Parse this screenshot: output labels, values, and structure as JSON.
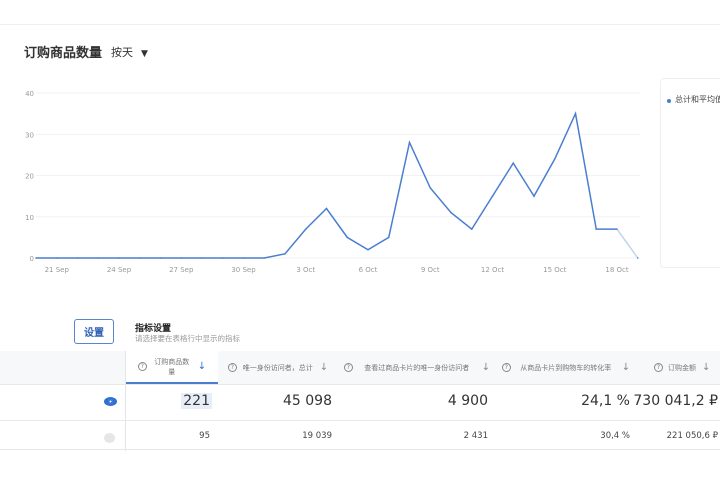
{
  "header": {
    "title": "订购商品数量",
    "period": "按天"
  },
  "legend": {
    "label": "总计和平均值"
  },
  "settings": {
    "button": "设置",
    "title": "指标设置",
    "subtitle": "请选择要在表格行中显示的指标"
  },
  "table": {
    "columns": [
      {
        "label": "订购商品数量"
      },
      {
        "label": "唯一身份访问者，总计"
      },
      {
        "label": "查看过商品卡片的唯一身份访问者"
      },
      {
        "label": "从商品卡片到购物车的转化率"
      },
      {
        "label": "订购金额"
      }
    ],
    "rows": [
      {
        "values": [
          "221",
          "45 098",
          "4 900",
          "24,1 %",
          "730 041,2 ₽"
        ]
      },
      {
        "values": [
          "95",
          "19 039",
          "2 431",
          "30,4 %",
          "221 050,6 ₽"
        ]
      }
    ]
  },
  "colors": {
    "accent": "#4a7ed0"
  },
  "chart_data": {
    "type": "line",
    "title": "订购商品数量",
    "x": [
      "20 Sep",
      "21 Sep",
      "22 Sep",
      "23 Sep",
      "24 Sep",
      "25 Sep",
      "26 Sep",
      "27 Sep",
      "28 Sep",
      "29 Sep",
      "30 Sep",
      "1 Oct",
      "2 Oct",
      "3 Oct",
      "4 Oct",
      "5 Oct",
      "6 Oct",
      "7 Oct",
      "8 Oct",
      "9 Oct",
      "10 Oct",
      "11 Oct",
      "12 Oct",
      "13 Oct",
      "14 Oct",
      "15 Oct",
      "16 Oct",
      "17 Oct",
      "18 Oct",
      "19 Oct"
    ],
    "series": [
      {
        "name": "总计和平均值",
        "values": [
          0,
          0,
          0,
          0,
          0,
          0,
          0,
          0,
          0,
          0,
          0,
          0,
          1,
          7,
          12,
          5,
          2,
          5,
          28,
          17,
          11,
          7,
          15,
          23,
          15,
          24,
          35,
          7,
          7,
          0
        ]
      }
    ],
    "xticks": [
      "21 Sep",
      "24 Sep",
      "27 Sep",
      "30 Sep",
      "3 Oct",
      "6 Oct",
      "9 Oct",
      "12 Oct",
      "15 Oct",
      "18 Oct"
    ],
    "yticks": [
      "0",
      "10",
      "20",
      "30",
      "40"
    ],
    "ylim": [
      0,
      40
    ],
    "grid": true,
    "legend": "right"
  }
}
